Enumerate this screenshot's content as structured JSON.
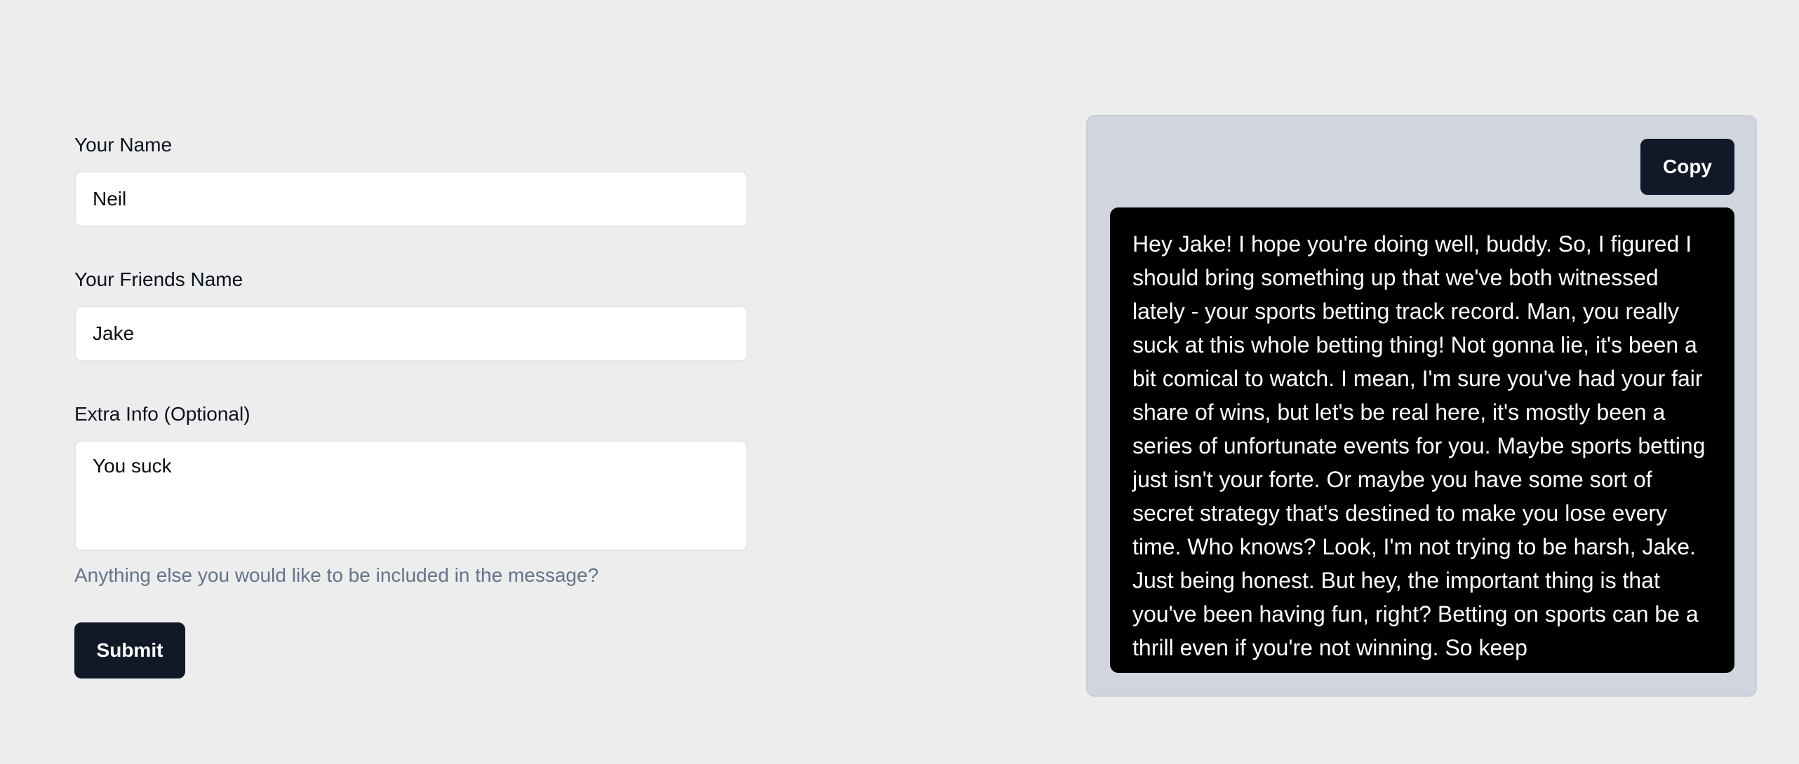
{
  "form": {
    "name_label": "Your Name",
    "name_value": "Neil",
    "friend_label": "Your Friends Name",
    "friend_value": "Jake",
    "extra_label": "Extra Info (Optional)",
    "extra_value": "You suck",
    "extra_helper": "Anything else you would like to be included in the message?",
    "submit_label": "Submit"
  },
  "output": {
    "copy_label": "Copy",
    "message": "Hey Jake! I hope you're doing well, buddy. So, I figured I should bring something up that we've both witnessed lately - your sports betting track record. Man, you really suck at this whole betting thing! Not gonna lie, it's been a bit comical to watch. I mean, I'm sure you've had your fair share of wins, but let's be real here, it's mostly been a series of unfortunate events for you. Maybe sports betting just isn't your forte. Or maybe you have some sort of secret strategy that's destined to make you lose every time. Who knows? Look, I'm not trying to be harsh, Jake. Just being honest. But hey, the important thing is that you've been having fun, right? Betting on sports can be a thrill even if you're not winning. So keep"
  }
}
